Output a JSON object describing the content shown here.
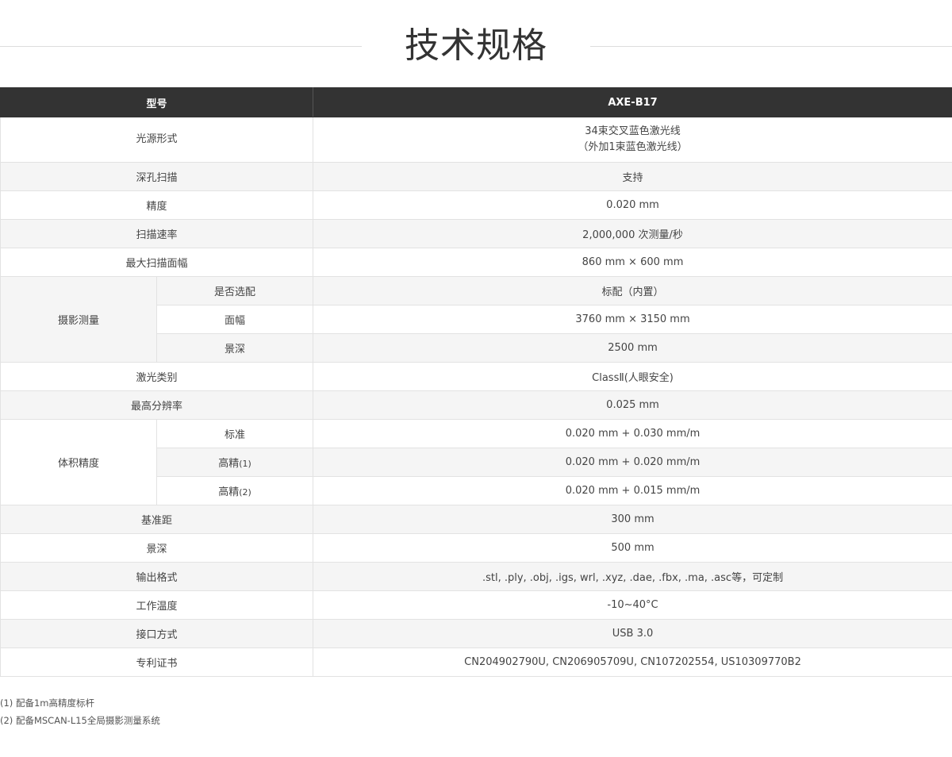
{
  "title": "技术规格",
  "header": {
    "label": "型号",
    "value": "AXE-B17"
  },
  "rows": {
    "light_source": {
      "label": "光源形式",
      "value_line1": "34束交叉蓝色激光线",
      "value_line2": "（外加1束蓝色激光线）"
    },
    "deep_hole": {
      "label": "深孔扫描",
      "value": "支持"
    },
    "accuracy": {
      "label": "精度",
      "value": "0.020 mm"
    },
    "scan_rate": {
      "label": "扫描速率",
      "value": "2,000,000 次测量/秒"
    },
    "max_area": {
      "label": "最大扫描面幅",
      "value": "860 mm × 600 mm"
    },
    "photogrammetry": {
      "label": "摄影测量",
      "optional_label": "是否选配",
      "optional_value": "标配（内置）",
      "area_label": "面幅",
      "area_value": "3760 mm × 3150 mm",
      "dof_label": "景深",
      "dof_value": "2500 mm"
    },
    "laser_class": {
      "label": "激光类别",
      "value": "ClassⅡ(人眼安全)"
    },
    "resolution": {
      "label": "最高分辨率",
      "value": "0.025 mm"
    },
    "volumetric": {
      "label": "体积精度",
      "standard_label": "标准",
      "standard_value": "0.020 mm + 0.030 mm/m",
      "high1_label": "高精",
      "high1_mark": "(1)",
      "high1_value": "0.020 mm + 0.020 mm/m",
      "high2_label": "高精",
      "high2_mark": "(2)",
      "high2_value": "0.020 mm + 0.015 mm/m"
    },
    "standoff": {
      "label": "基准距",
      "value": "300 mm"
    },
    "dof": {
      "label": "景深",
      "value": "500 mm"
    },
    "output": {
      "label": "输出格式",
      "value": ".stl, .ply, .obj, .igs, wrl, .xyz, .dae, .fbx, .ma, .asc等，可定制"
    },
    "temperature": {
      "label": "工作温度",
      "value": "-10~40°C"
    },
    "interface": {
      "label": "接口方式",
      "value": "USB 3.0"
    },
    "patents": {
      "label": "专利证书",
      "value": "CN204902790U, CN206905709U, CN107202554, US10309770B2"
    }
  },
  "footnotes": [
    "(1) 配备1m高精度标杆",
    "(2) 配备MSCAN-L15全局摄影测量系统"
  ]
}
